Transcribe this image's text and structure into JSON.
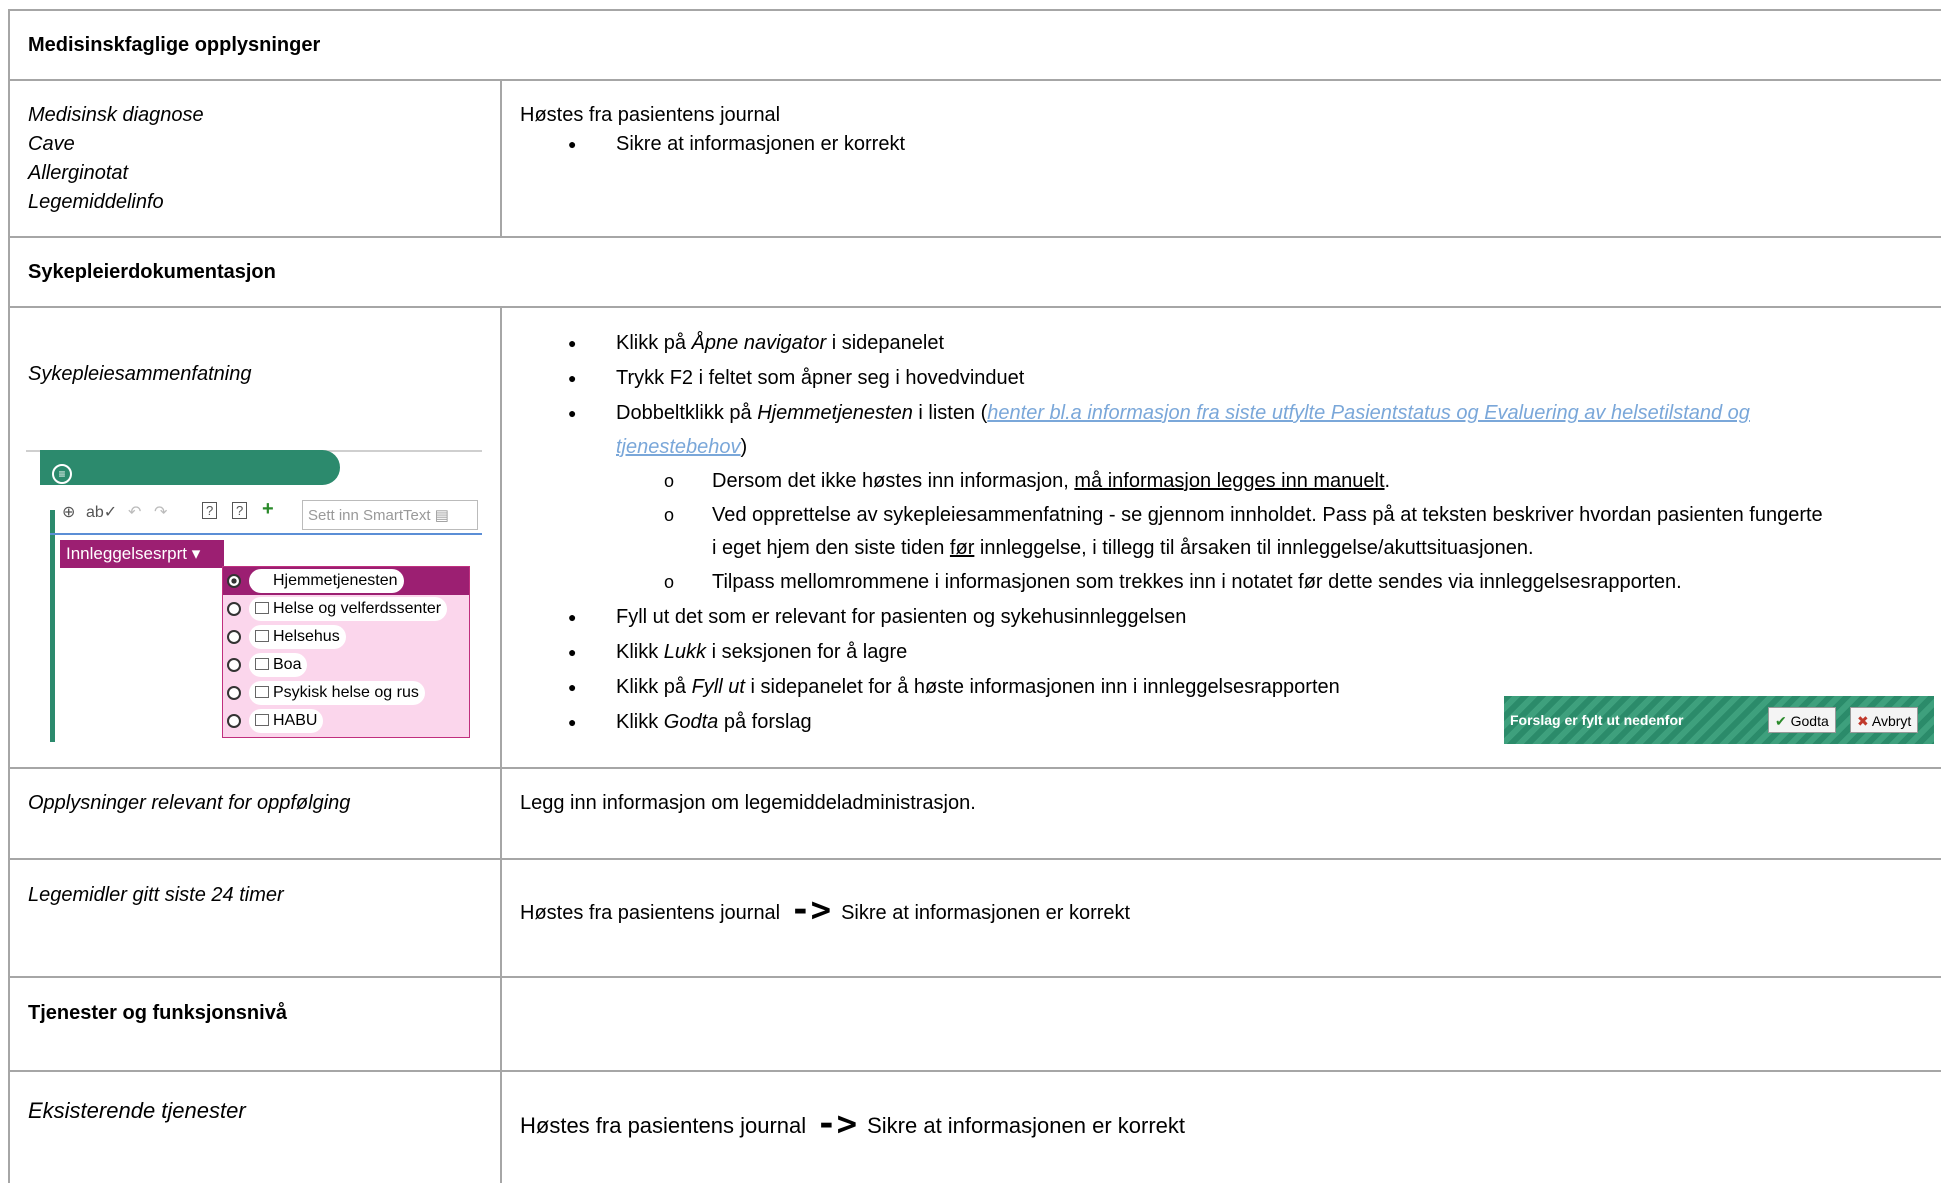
{
  "sections": {
    "medisinsk": "Medisinskfaglige opplysninger",
    "sykepleier": "Sykepleierdokumentasjon",
    "tjenester": "Tjenester og funksjonsnivå"
  },
  "row1": {
    "labels": [
      "Medisinsk diagnose",
      "Cave",
      "Allerginotat",
      "Legemiddelinfo"
    ],
    "text": "Høstes fra pasientens journal",
    "bullet": "Sikre at informasjonen er korrekt"
  },
  "row2": {
    "label": "Sykepleiesammenfatning",
    "b1_pre": "Klikk på ",
    "b1_it": "Åpne navigator",
    "b1_post": " i sidepanelet",
    "b2": "Trykk F2 i feltet som åpner seg i hovedvinduet",
    "b3_pre": "Dobbeltklikk på ",
    "b3_it": "Hjemmetjenesten",
    "b3_mid": " i listen (",
    "b3_link1": "henter bl.a  informasjon fra siste utfylte Pasientstatus og Evaluering av helsetilstand og",
    "b3_link2": "tjenestebehov",
    "b3_close": ")",
    "s1_pre": "Dersom det ikke høstes inn informasjon, ",
    "s1_u": "må informasjon legges inn manuelt",
    "s1_post": ".",
    "s2_line1": "Ved opprettelse av sykepleiesammenfatning - se gjennom innholdet. Pass på at teksten beskriver hvordan pasienten fungerte",
    "s2_pre": "i eget hjem den siste tiden ",
    "s2_u": "før",
    "s2_post": " innleggelse, i tillegg til årsaken til innleggelse/akuttsituasjonen.",
    "s3": "Tilpass mellomrommene i informasjonen som trekkes inn i notatet før dette sendes via innleggelsesrapporten.",
    "b4": "Fyll ut det som er relevant for pasienten og sykehusinnleggelsen",
    "b5_pre": "Klikk ",
    "b5_it": "Lukk",
    "b5_post": " i seksjonen for å lagre",
    "b6_pre": "Klikk på ",
    "b6_it": "Fyll ut",
    "b6_post": " i sidepanelet for å høste informasjonen inn i innleggelsesrapporten",
    "b7_pre": "Klikk ",
    "b7_it": "Godta",
    "b7_post": " på forslag"
  },
  "screenshot": {
    "title": "Sykepleiesammenfatning",
    "smarttext": "Sett inn SmartText",
    "dropdown": "Innleggelsesrprt",
    "options": [
      "Hjemmetjenesten",
      "Helse og velferdssenter",
      "Helsehus",
      "Boa",
      "Psykisk helse og rus",
      "HABU"
    ]
  },
  "banner": {
    "text": "Forslag er fylt ut nedenfor",
    "accept": "Godta",
    "cancel": "Avbryt"
  },
  "row3": {
    "label": "Opplysninger relevant for oppfølging",
    "text": "Legg inn informasjon om legemiddeladministrasjon."
  },
  "row4": {
    "label": "Legemidler gitt siste 24 timer",
    "pre": "Høstes fra pasientens journal",
    "arrow": "->",
    "post": "Sikre at informasjonen er korrekt"
  },
  "row5": {
    "label": "Eksisterende tjenester",
    "pre": "Høstes fra pasientens journal",
    "arrow": "->",
    "post": "Sikre at informasjonen er korrekt"
  }
}
